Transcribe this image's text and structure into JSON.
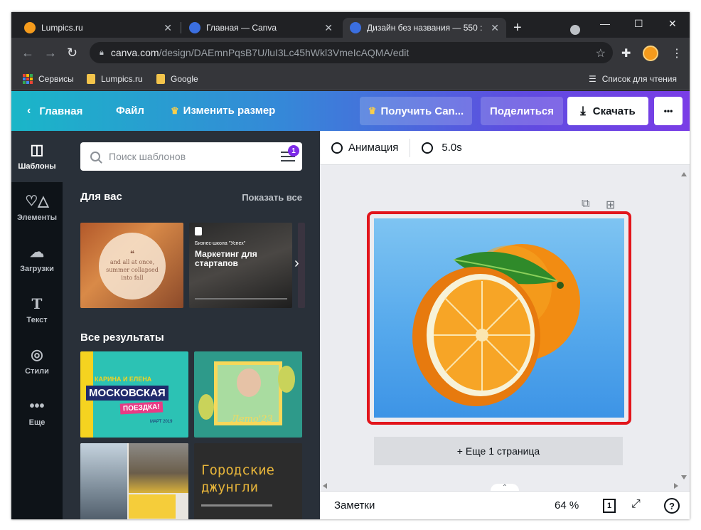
{
  "browser": {
    "tabs": [
      {
        "title": "Lumpics.ru",
        "favicon_color": "#f59b1c"
      },
      {
        "title": "Главная — Canva",
        "favicon_color": "#3b6fe0"
      },
      {
        "title": "Дизайн без названия — 550 :",
        "favicon_color": "#3b6fe0"
      }
    ],
    "new_tab": "+",
    "url_host": "canva.com",
    "url_path": "/design/DAEmnPqsB7U/luI3Lc45hWkl3VmeIcAQMA/edit",
    "bookmarks": [
      {
        "label": "Сервисы"
      },
      {
        "label": "Lumpics.ru"
      },
      {
        "label": "Google"
      }
    ],
    "reading_list": "Список для чтения"
  },
  "header": {
    "home": "Главная",
    "file": "Файл",
    "resize": "Изменить размер",
    "get_pro": "Получить Can...",
    "share": "Поделиться",
    "download": "Скачать",
    "more": "•••"
  },
  "rail": [
    {
      "label": "Шаблоны",
      "icon": "layout-icon"
    },
    {
      "label": "Элементы",
      "icon": "shapes-icon"
    },
    {
      "label": "Загрузки",
      "icon": "cloud-upload-icon"
    },
    {
      "label": "Текст",
      "icon": "text-icon"
    },
    {
      "label": "Стили",
      "icon": "palette-icon"
    },
    {
      "label": "Еще",
      "icon": "more-icon"
    }
  ],
  "panel": {
    "search_placeholder": "Поиск шаблонов",
    "filter_count": "1",
    "for_you": "Для вас",
    "show_all": "Показать все",
    "all_results": "Все результаты",
    "templates": {
      "autumn_line1": "and all at once,",
      "autumn_line2": "summer collapsed",
      "autumn_line3": "into fall",
      "biz_school": "Бизнес-школа \"Успех\"",
      "biz_title_1": "Маркетинг для",
      "biz_title_2": "стартапов",
      "moscow_names": "КАРИНА И ЕЛЕНА",
      "moscow_title": "МОСКОВСКАЯ",
      "moscow_trip": "ПОЕЗДКА!",
      "moscow_date": "МАРТ 2019",
      "summer": "Лето'23",
      "city_title_1": "Городские",
      "city_title_2": "джунгли"
    }
  },
  "editor": {
    "animation": "Анимация",
    "duration": "5.0s",
    "add_page": "+ Еще 1 страница",
    "notes": "Заметки",
    "zoom": "64 %",
    "page_count": "1",
    "help": "?"
  },
  "colors": {
    "highlight": "#e2151b",
    "accent": "#7d2ae8"
  }
}
